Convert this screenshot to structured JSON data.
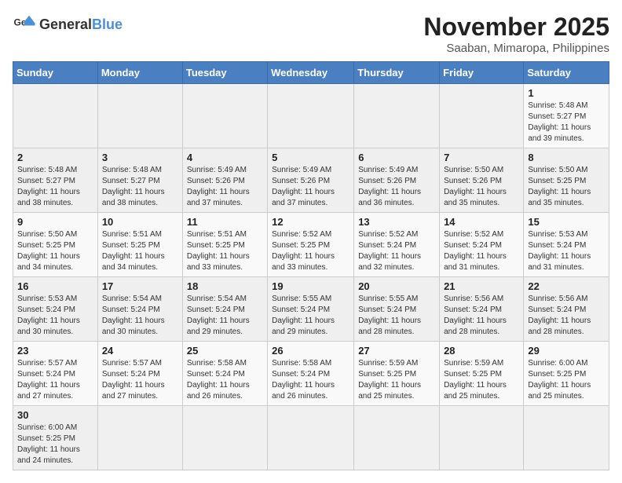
{
  "header": {
    "logo_general": "General",
    "logo_blue": "Blue",
    "month_title": "November 2025",
    "location": "Saaban, Mimaropa, Philippines"
  },
  "weekdays": [
    "Sunday",
    "Monday",
    "Tuesday",
    "Wednesday",
    "Thursday",
    "Friday",
    "Saturday"
  ],
  "weeks": [
    [
      {
        "day": "",
        "info": ""
      },
      {
        "day": "",
        "info": ""
      },
      {
        "day": "",
        "info": ""
      },
      {
        "day": "",
        "info": ""
      },
      {
        "day": "",
        "info": ""
      },
      {
        "day": "",
        "info": ""
      },
      {
        "day": "1",
        "info": "Sunrise: 5:48 AM\nSunset: 5:27 PM\nDaylight: 11 hours\nand 39 minutes."
      }
    ],
    [
      {
        "day": "2",
        "info": "Sunrise: 5:48 AM\nSunset: 5:27 PM\nDaylight: 11 hours\nand 38 minutes."
      },
      {
        "day": "3",
        "info": "Sunrise: 5:48 AM\nSunset: 5:27 PM\nDaylight: 11 hours\nand 38 minutes."
      },
      {
        "day": "4",
        "info": "Sunrise: 5:49 AM\nSunset: 5:26 PM\nDaylight: 11 hours\nand 37 minutes."
      },
      {
        "day": "5",
        "info": "Sunrise: 5:49 AM\nSunset: 5:26 PM\nDaylight: 11 hours\nand 37 minutes."
      },
      {
        "day": "6",
        "info": "Sunrise: 5:49 AM\nSunset: 5:26 PM\nDaylight: 11 hours\nand 36 minutes."
      },
      {
        "day": "7",
        "info": "Sunrise: 5:50 AM\nSunset: 5:26 PM\nDaylight: 11 hours\nand 35 minutes."
      },
      {
        "day": "8",
        "info": "Sunrise: 5:50 AM\nSunset: 5:25 PM\nDaylight: 11 hours\nand 35 minutes."
      }
    ],
    [
      {
        "day": "9",
        "info": "Sunrise: 5:50 AM\nSunset: 5:25 PM\nDaylight: 11 hours\nand 34 minutes."
      },
      {
        "day": "10",
        "info": "Sunrise: 5:51 AM\nSunset: 5:25 PM\nDaylight: 11 hours\nand 34 minutes."
      },
      {
        "day": "11",
        "info": "Sunrise: 5:51 AM\nSunset: 5:25 PM\nDaylight: 11 hours\nand 33 minutes."
      },
      {
        "day": "12",
        "info": "Sunrise: 5:52 AM\nSunset: 5:25 PM\nDaylight: 11 hours\nand 33 minutes."
      },
      {
        "day": "13",
        "info": "Sunrise: 5:52 AM\nSunset: 5:24 PM\nDaylight: 11 hours\nand 32 minutes."
      },
      {
        "day": "14",
        "info": "Sunrise: 5:52 AM\nSunset: 5:24 PM\nDaylight: 11 hours\nand 31 minutes."
      },
      {
        "day": "15",
        "info": "Sunrise: 5:53 AM\nSunset: 5:24 PM\nDaylight: 11 hours\nand 31 minutes."
      }
    ],
    [
      {
        "day": "16",
        "info": "Sunrise: 5:53 AM\nSunset: 5:24 PM\nDaylight: 11 hours\nand 30 minutes."
      },
      {
        "day": "17",
        "info": "Sunrise: 5:54 AM\nSunset: 5:24 PM\nDaylight: 11 hours\nand 30 minutes."
      },
      {
        "day": "18",
        "info": "Sunrise: 5:54 AM\nSunset: 5:24 PM\nDaylight: 11 hours\nand 29 minutes."
      },
      {
        "day": "19",
        "info": "Sunrise: 5:55 AM\nSunset: 5:24 PM\nDaylight: 11 hours\nand 29 minutes."
      },
      {
        "day": "20",
        "info": "Sunrise: 5:55 AM\nSunset: 5:24 PM\nDaylight: 11 hours\nand 28 minutes."
      },
      {
        "day": "21",
        "info": "Sunrise: 5:56 AM\nSunset: 5:24 PM\nDaylight: 11 hours\nand 28 minutes."
      },
      {
        "day": "22",
        "info": "Sunrise: 5:56 AM\nSunset: 5:24 PM\nDaylight: 11 hours\nand 28 minutes."
      }
    ],
    [
      {
        "day": "23",
        "info": "Sunrise: 5:57 AM\nSunset: 5:24 PM\nDaylight: 11 hours\nand 27 minutes."
      },
      {
        "day": "24",
        "info": "Sunrise: 5:57 AM\nSunset: 5:24 PM\nDaylight: 11 hours\nand 27 minutes."
      },
      {
        "day": "25",
        "info": "Sunrise: 5:58 AM\nSunset: 5:24 PM\nDaylight: 11 hours\nand 26 minutes."
      },
      {
        "day": "26",
        "info": "Sunrise: 5:58 AM\nSunset: 5:24 PM\nDaylight: 11 hours\nand 26 minutes."
      },
      {
        "day": "27",
        "info": "Sunrise: 5:59 AM\nSunset: 5:25 PM\nDaylight: 11 hours\nand 25 minutes."
      },
      {
        "day": "28",
        "info": "Sunrise: 5:59 AM\nSunset: 5:25 PM\nDaylight: 11 hours\nand 25 minutes."
      },
      {
        "day": "29",
        "info": "Sunrise: 6:00 AM\nSunset: 5:25 PM\nDaylight: 11 hours\nand 25 minutes."
      }
    ],
    [
      {
        "day": "30",
        "info": "Sunrise: 6:00 AM\nSunset: 5:25 PM\nDaylight: 11 hours\nand 24 minutes."
      },
      {
        "day": "",
        "info": ""
      },
      {
        "day": "",
        "info": ""
      },
      {
        "day": "",
        "info": ""
      },
      {
        "day": "",
        "info": ""
      },
      {
        "day": "",
        "info": ""
      },
      {
        "day": "",
        "info": ""
      }
    ]
  ]
}
